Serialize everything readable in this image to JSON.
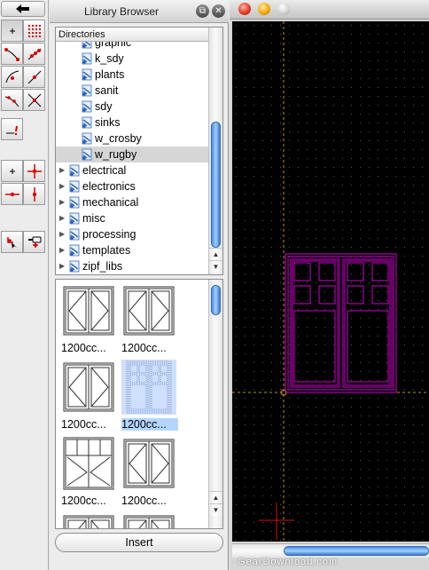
{
  "panel": {
    "title": "Library Browser",
    "directories_header": "Directories",
    "tree": [
      {
        "label": "graphic",
        "indent": 1,
        "expandable": false,
        "selected": false
      },
      {
        "label": "k_sdy",
        "indent": 1,
        "expandable": false,
        "selected": false
      },
      {
        "label": "plants",
        "indent": 1,
        "expandable": false,
        "selected": false
      },
      {
        "label": "sanit",
        "indent": 1,
        "expandable": false,
        "selected": false
      },
      {
        "label": "sdy",
        "indent": 1,
        "expandable": false,
        "selected": false
      },
      {
        "label": "sinks",
        "indent": 1,
        "expandable": false,
        "selected": false
      },
      {
        "label": "w_crosby",
        "indent": 1,
        "expandable": false,
        "selected": false
      },
      {
        "label": "w_rugby",
        "indent": 1,
        "expandable": false,
        "selected": true
      },
      {
        "label": "electrical",
        "indent": 0,
        "expandable": true,
        "selected": false
      },
      {
        "label": "electronics",
        "indent": 0,
        "expandable": true,
        "selected": false
      },
      {
        "label": "mechanical",
        "indent": 0,
        "expandable": true,
        "selected": false
      },
      {
        "label": "misc",
        "indent": 0,
        "expandable": true,
        "selected": false
      },
      {
        "label": "processing",
        "indent": 0,
        "expandable": true,
        "selected": false
      },
      {
        "label": "templates",
        "indent": 0,
        "expandable": true,
        "selected": false
      },
      {
        "label": "zipf_libs",
        "indent": 0,
        "expandable": true,
        "selected": false
      }
    ],
    "thumbnails": [
      {
        "caption": "1200cc...",
        "icon": "window-casement-icon",
        "selected": false
      },
      {
        "caption": "1200cc...",
        "icon": "window-casement-icon",
        "selected": false
      },
      {
        "caption": "1200cc...",
        "icon": "window-casement-icon",
        "selected": false
      },
      {
        "caption": "1200cc...",
        "icon": "window-rugby-icon",
        "selected": true
      },
      {
        "caption": "1200cc...",
        "icon": "window-casement-transom-icon",
        "selected": false
      },
      {
        "caption": "1200cc...",
        "icon": "window-casement-icon",
        "selected": false
      },
      {
        "caption": "",
        "icon": "window-casement-icon",
        "selected": false
      },
      {
        "caption": "",
        "icon": "window-casement-icon",
        "selected": false
      }
    ],
    "insert_label": "Insert"
  },
  "toolbar": {
    "back_icon": "arrow-left-icon",
    "buttons": [
      "snap-free-icon",
      "snap-grid-icon",
      "snap-endpoint-icon",
      "snap-on-entity-icon",
      "snap-center-icon",
      "snap-middle-icon",
      "snap-distance-icon",
      "snap-intersection-icon",
      "snap-reference-icon",
      "restrict-nothing-icon",
      "restrict-orthogonal-icon",
      "restrict-horizontal-icon",
      "restrict-vertical-icon",
      "relative-zero-icon",
      "lock-relative-zero-icon"
    ]
  },
  "drawing": {
    "window_buttons": [
      "close",
      "minimize",
      "zoom"
    ],
    "colors": {
      "background": "#000000",
      "grid": "#5a5a5a",
      "entity": "#d000d0",
      "crosshair": "#c89000",
      "origin": "#d01010"
    }
  },
  "watermark": "GearDownload.com"
}
